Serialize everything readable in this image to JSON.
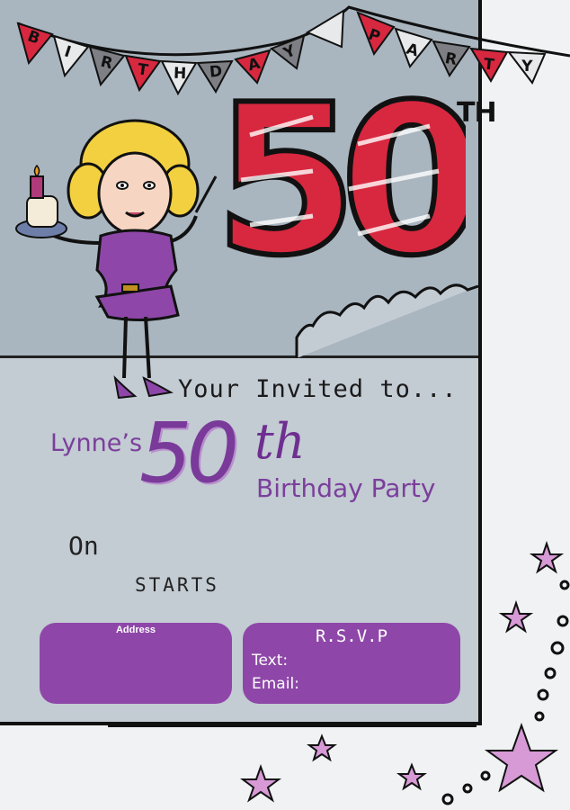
{
  "bunting": {
    "letters": [
      "B",
      "I",
      "R",
      "T",
      "H",
      "D",
      "A",
      "Y",
      "P",
      "A",
      "R",
      "T",
      "Y"
    ]
  },
  "hero": {
    "number": "50",
    "suffix": "TH"
  },
  "invite": {
    "headline": "Your Invited to...",
    "name": "Lynne’s",
    "number": "50",
    "ordinal": "th",
    "event": "Birthday Party",
    "on_label": "On",
    "starts_label": "STARTS"
  },
  "address_box": {
    "label": "Address"
  },
  "rsvp_box": {
    "title": "R.S.V.P",
    "text_label": "Text:",
    "email_label": "Email:"
  },
  "colors": {
    "purple": "#8e47a8",
    "card": "#c3cbd3",
    "accent_red": "#d7283f",
    "star_pink": "#d79ad6"
  }
}
